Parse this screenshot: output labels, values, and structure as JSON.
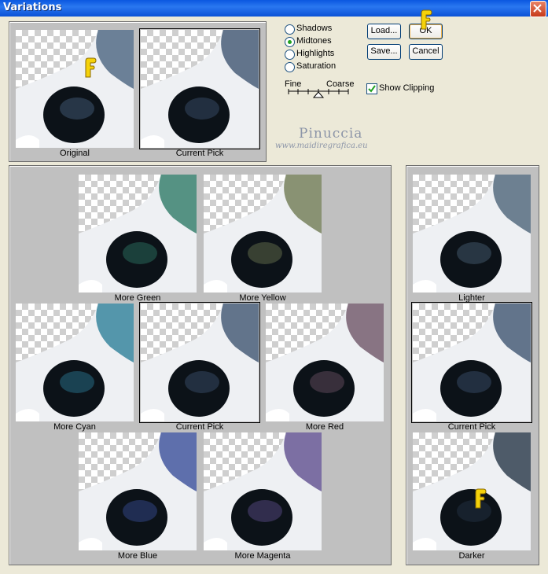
{
  "window": {
    "title": "Variations"
  },
  "top_preview": {
    "original_caption": "Original",
    "current_pick_caption": "Current Pick"
  },
  "adjust_options": [
    {
      "label": "Shadows",
      "selected": false
    },
    {
      "label": "Midtones",
      "selected": true
    },
    {
      "label": "Highlights",
      "selected": false
    },
    {
      "label": "Saturation",
      "selected": false
    }
  ],
  "slider": {
    "fine_label": "Fine",
    "coarse_label": "Coarse"
  },
  "buttons": {
    "load": "Load...",
    "save": "Save...",
    "ok": "OK",
    "cancel": "Cancel"
  },
  "show_clipping": {
    "label": "Show Clipping",
    "checked": true
  },
  "watermark": {
    "name": "Pinuccia",
    "url": "www.maidiregrafica.eu"
  },
  "color_variations": [
    {
      "label": "More Green",
      "tint": "#2e7a66"
    },
    {
      "label": "More Yellow",
      "tint": "#6f7a52"
    },
    {
      "label": "More Cyan",
      "tint": "#2d7f98"
    },
    {
      "label": "Current Pick",
      "tint": "#3f5570"
    },
    {
      "label": "More Red",
      "tint": "#6e5566"
    },
    {
      "label": "More Blue",
      "tint": "#3a4f9a"
    },
    {
      "label": "More Magenta",
      "tint": "#5f4f8e"
    }
  ],
  "brightness_variations": [
    {
      "label": "Lighter",
      "tint": "#4c6478"
    },
    {
      "label": "Current Pick",
      "tint": "#3f5570"
    },
    {
      "label": "Darker",
      "tint": "#263646"
    }
  ],
  "colors": {
    "titlebar": "#0b52d6",
    "dialog_bg": "#ece9d8",
    "panel_bg": "#c0c0c0",
    "original_tint": "#4a6480"
  }
}
